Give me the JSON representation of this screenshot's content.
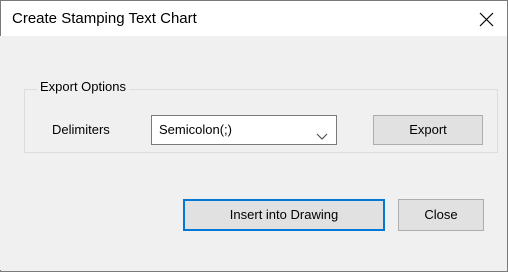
{
  "window": {
    "title": "Create Stamping Text Chart"
  },
  "export_options": {
    "legend": "Export Options",
    "delimiters_label": "Delimiters",
    "delimiters_value": "Semicolon(;)",
    "export_label": "Export"
  },
  "actions": {
    "insert_label": "Insert into Drawing",
    "close_label": "Close"
  },
  "colors": {
    "focus_border": "#0078d7",
    "dialog_bg": "#f0f0f0",
    "button_bg": "#e1e1e1"
  },
  "icons": {
    "close": "close-icon",
    "dropdown": "chevron-down-icon"
  }
}
